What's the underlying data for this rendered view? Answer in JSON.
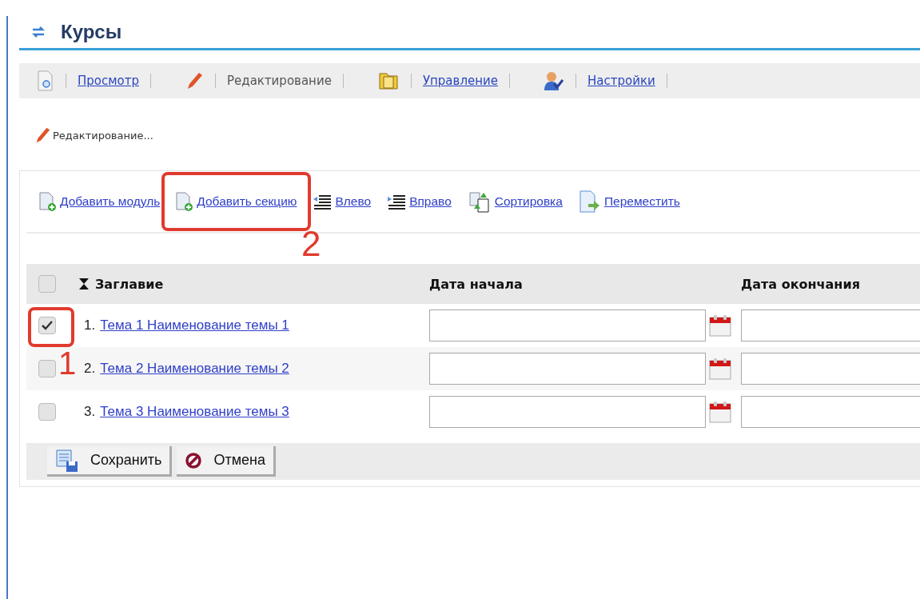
{
  "title": "Курсы",
  "modes": [
    {
      "label": "Просмотр",
      "kind": "view",
      "selected": false
    },
    {
      "label": "Редактирование",
      "kind": "edit",
      "selected": true
    },
    {
      "label": "Управление",
      "kind": "manage",
      "selected": false
    },
    {
      "label": "Настройки",
      "kind": "settings",
      "selected": false
    }
  ],
  "status": "Редактирование...",
  "actions": [
    {
      "label": "Добавить модуль",
      "kind": "add"
    },
    {
      "label": "Добавить секцию",
      "kind": "add",
      "callout": "2"
    },
    {
      "label": "Влево",
      "kind": "indent-left"
    },
    {
      "label": "Вправо",
      "kind": "indent-right"
    },
    {
      "label": "Сортировка",
      "kind": "sort"
    },
    {
      "label": "Переместить",
      "kind": "move"
    }
  ],
  "table": {
    "all_checked": false,
    "columns": [
      "Заглавие",
      "Дата начала",
      "Дата окончания"
    ],
    "rows": [
      {
        "number": "1.",
        "title": "Тема 1 Наименование темы 1",
        "checked": true,
        "callout": "1"
      },
      {
        "number": "2.",
        "title": "Тема 2 Наименование темы 2",
        "checked": false
      },
      {
        "number": "3.",
        "title": "Тема 3 Наименование темы 3",
        "checked": false
      }
    ]
  },
  "buttons": [
    {
      "label": "Сохранить",
      "kind": "save"
    },
    {
      "label": "Отмена",
      "kind": "cancel"
    }
  ]
}
